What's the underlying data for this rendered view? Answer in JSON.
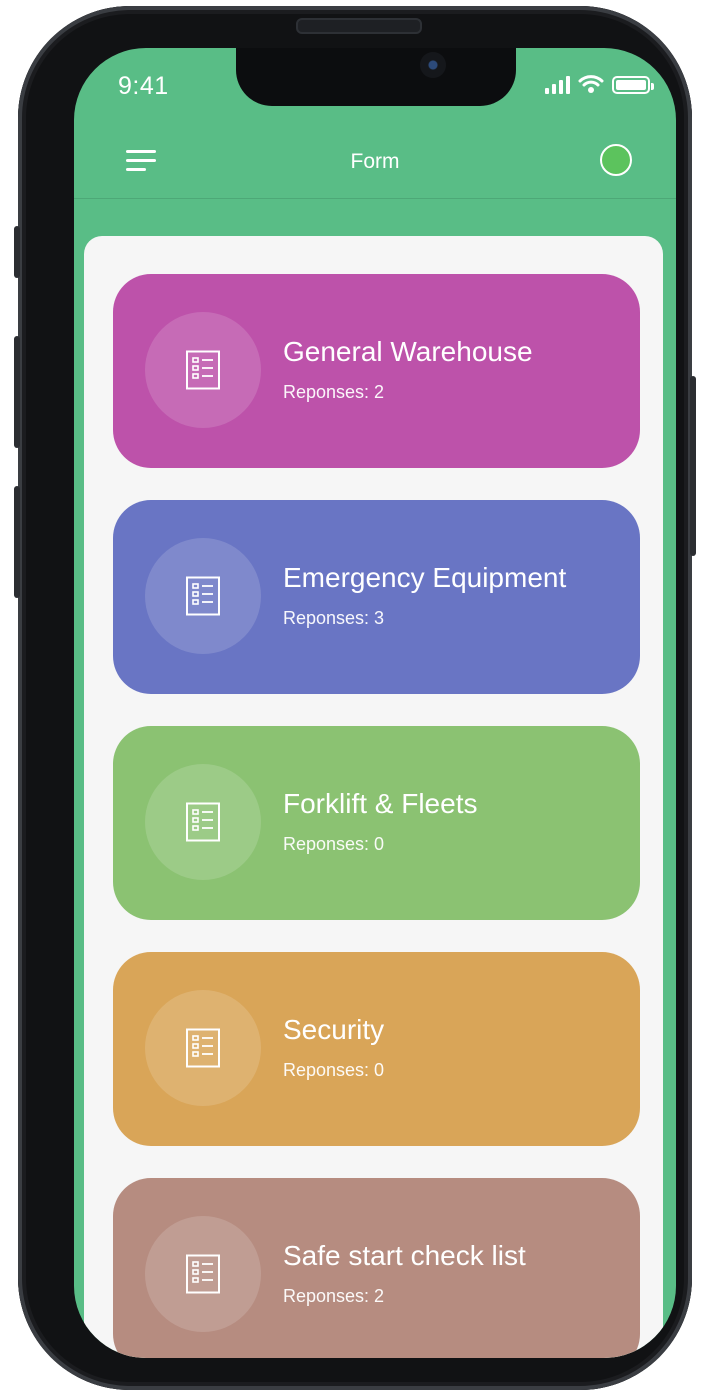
{
  "status_bar": {
    "time": "9:41"
  },
  "header": {
    "title": "Form"
  },
  "colors": {
    "app_green": "#59bd86",
    "content_bg": "#f6f6f6",
    "avatar": "#5cc35d"
  },
  "forms": [
    {
      "name": "General Warehouse",
      "responses": "Reponses: 2",
      "color": "#bd52aa",
      "icon": "checklist-icon"
    },
    {
      "name": "Emergency Equipment",
      "responses": "Reponses: 3",
      "color": "#6975c4",
      "icon": "checklist-icon"
    },
    {
      "name": "Forklift & Fleets",
      "responses": "Reponses: 0",
      "color": "#8bc272",
      "icon": "checklist-icon"
    },
    {
      "name": "Security",
      "responses": "Reponses: 0",
      "color": "#d9a558",
      "icon": "checklist-icon"
    },
    {
      "name": "Safe start check list",
      "responses": "Reponses: 2",
      "color": "#b68c80",
      "icon": "checklist-icon"
    }
  ]
}
